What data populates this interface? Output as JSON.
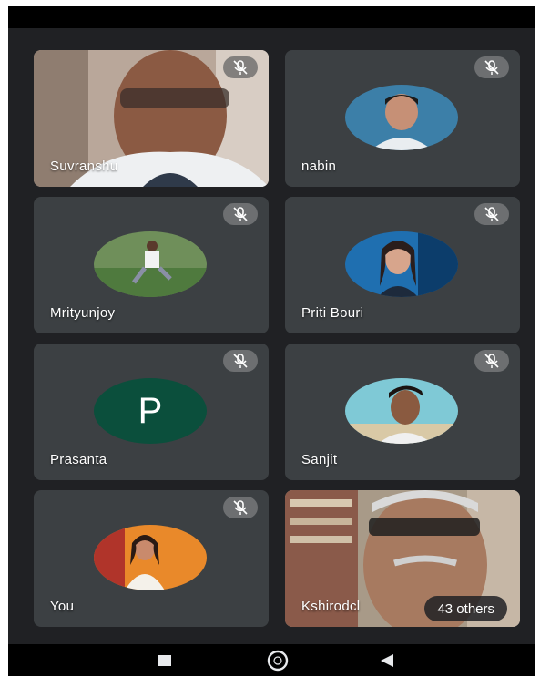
{
  "participants": [
    {
      "name": "Suvranshu",
      "muted": true,
      "kind": "video"
    },
    {
      "name": "nabin",
      "muted": true,
      "kind": "photo"
    },
    {
      "name": "Mrityunjoy",
      "muted": true,
      "kind": "photo"
    },
    {
      "name": "Priti Bouri",
      "muted": true,
      "kind": "photo"
    },
    {
      "name": "Prasanta",
      "muted": true,
      "kind": "letter",
      "initial": "P",
      "avatar_color": "#0b4f3c"
    },
    {
      "name": "Sanjit",
      "muted": true,
      "kind": "photo"
    },
    {
      "name": "You",
      "muted": true,
      "kind": "photo"
    },
    {
      "name": "Kshirodcl",
      "muted": false,
      "kind": "video",
      "others_label": "43 others"
    }
  ],
  "nav": {
    "recents": "square-icon",
    "home": "circle-icon",
    "back": "triangle-back-icon"
  },
  "colors": {
    "background": "#202124",
    "tile": "#3c4043",
    "nav_bar": "#000000"
  }
}
